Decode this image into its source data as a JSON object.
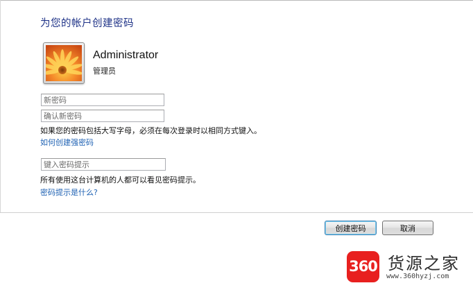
{
  "dialog": {
    "heading": "为您的帐户创建密码",
    "user": {
      "name": "Administrator",
      "role": "管理员",
      "avatar_icon": "flower-avatar-icon"
    },
    "fields": {
      "new_password_placeholder": "新密码",
      "confirm_password_placeholder": "确认新密码",
      "hint_placeholder": "键入密码提示"
    },
    "notes": {
      "case_sensitive": "如果您的密码包括大写字母，必须在每次登录时以相同方式键入。",
      "hint_visible": "所有使用这台计算机的人都可以看见密码提示。"
    },
    "links": {
      "strong_password": "如何创建强密码",
      "what_is_hint": "密码提示是什么?"
    },
    "buttons": {
      "create": "创建密码",
      "cancel": "取消"
    }
  },
  "watermark": {
    "badge": "360",
    "title": "货源之家",
    "url": "www.360hyzj.com"
  },
  "colors": {
    "heading": "#1e3287",
    "link": "#1f62b3",
    "watermark_badge": "#e8201f"
  }
}
